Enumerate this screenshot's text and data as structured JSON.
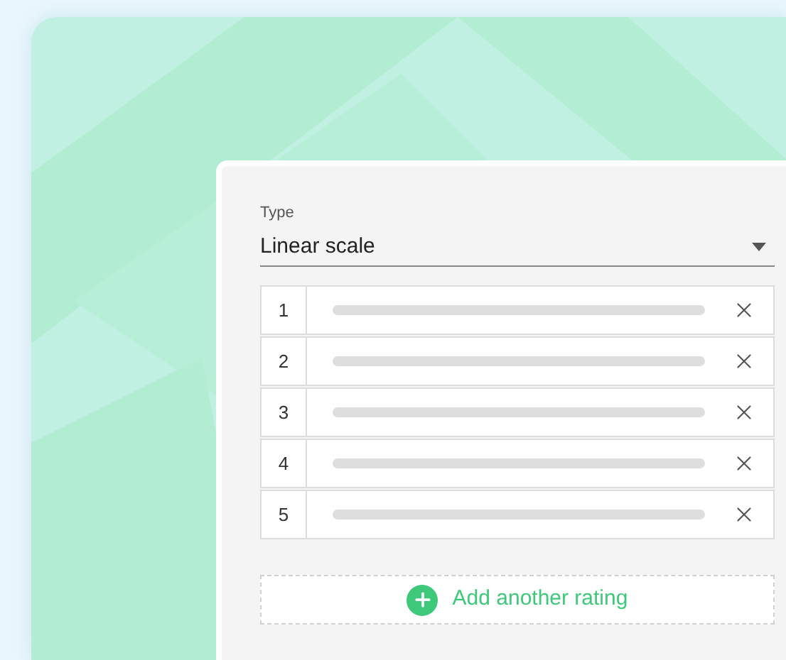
{
  "type_select": {
    "label": "Type",
    "value": "Linear scale"
  },
  "ratings": [
    {
      "number": "1"
    },
    {
      "number": "2"
    },
    {
      "number": "3"
    },
    {
      "number": "4"
    },
    {
      "number": "5"
    }
  ],
  "add_button": {
    "label": "Add another rating"
  }
}
